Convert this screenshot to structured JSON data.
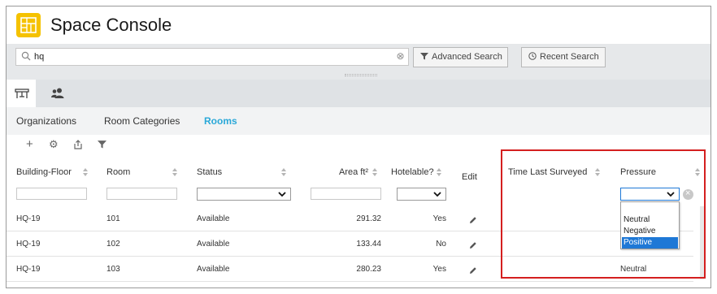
{
  "app": {
    "title": "Space Console"
  },
  "search": {
    "value": "hq",
    "clear_glyph": "⊗",
    "advanced_label": "Advanced Search",
    "recent_label": "Recent Search"
  },
  "mode_tabs": [
    {
      "icon": "floorplan-icon",
      "active": true
    },
    {
      "icon": "people-icon",
      "active": false
    }
  ],
  "sub_tabs": [
    {
      "label": "Organizations",
      "active": false
    },
    {
      "label": "Room Categories",
      "active": false
    },
    {
      "label": "Rooms",
      "active": true
    }
  ],
  "toolbar": {
    "add": "+",
    "settings": "⚙",
    "export": "⇪",
    "filter": "⏷"
  },
  "columns": {
    "building_floor": "Building-Floor",
    "room": "Room",
    "status": "Status",
    "area": "Area ft²",
    "hotelable": "Hotelable?",
    "edit": "Edit",
    "time_last_surveyed": "Time Last Surveyed",
    "pressure": "Pressure"
  },
  "rows": [
    {
      "building_floor": "HQ-19",
      "room": "101",
      "status": "Available",
      "area": "291.32",
      "hotelable": "Yes",
      "pressure": ""
    },
    {
      "building_floor": "HQ-19",
      "room": "102",
      "status": "Available",
      "area": "133.44",
      "hotelable": "No",
      "pressure": ""
    },
    {
      "building_floor": "HQ-19",
      "room": "103",
      "status": "Available",
      "area": "280.23",
      "hotelable": "Yes",
      "pressure": "Neutral"
    }
  ],
  "pressure_dropdown": {
    "options": [
      "",
      "Neutral",
      "Negative",
      "Positive"
    ],
    "highlighted": "Positive"
  },
  "colors": {
    "accent": "#2aa8d8",
    "logo": "#f5c200",
    "highlight_border": "#d41f1f",
    "selected_option": "#1e78d6"
  }
}
